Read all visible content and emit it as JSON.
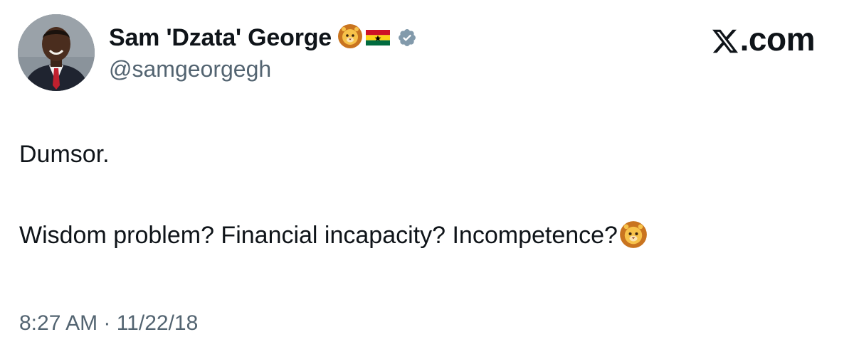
{
  "author": {
    "display_name": "Sam 'Dzata' George",
    "handle": "@samgeorgegh",
    "name_emoji_icon": "lion-face-icon",
    "flag_icon": "ghana-flag-icon",
    "verified_icon": "verified-badge-icon"
  },
  "brand": {
    "label": ".com",
    "logo_icon": "x-logo-icon"
  },
  "tweet": {
    "paragraphs": [
      "Dumsor.",
      "Wisdom problem? Financial incapacity? Incompetence?"
    ],
    "trailing_emoji_icon": "lion-face-icon"
  },
  "timestamp": "8:27 AM · 11/22/18",
  "colors": {
    "text_primary": "#0f1419",
    "text_secondary": "#536471",
    "verified_badge": "#829aab",
    "background": "#ffffff"
  }
}
